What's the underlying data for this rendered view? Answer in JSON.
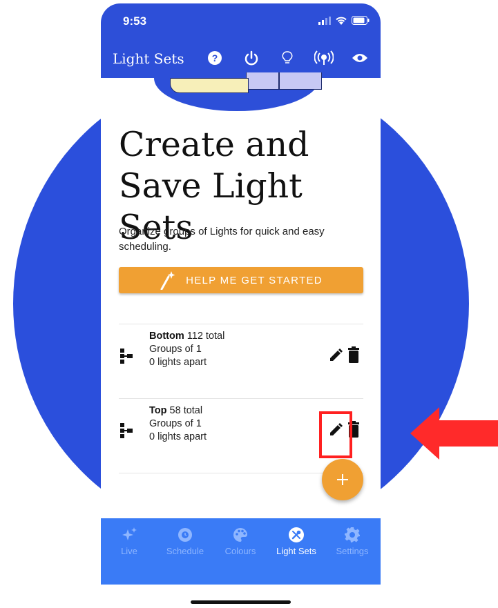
{
  "status_bar": {
    "time": "9:53"
  },
  "app_bar": {
    "title": "Light Sets",
    "icons": [
      "help-icon",
      "power-icon",
      "bulb-icon",
      "broadcast-icon",
      "eye-icon"
    ]
  },
  "hero": {
    "headline_line1": "Create and",
    "headline_line2": "Save Light Sets",
    "subtitle": "Organize groups of Lights for quick and easy scheduling."
  },
  "help_button": {
    "label": "HELP ME GET STARTED",
    "icon": "magic-wand-icon"
  },
  "light_sets": [
    {
      "name": "Bottom",
      "total": "112 total",
      "groups": "Groups of 1",
      "spacing": "0 lights apart"
    },
    {
      "name": "Top",
      "total": "58 total",
      "groups": "Groups of 1",
      "spacing": "0 lights apart"
    }
  ],
  "fab": {
    "label": "+"
  },
  "bottom_nav": [
    {
      "label": "Live",
      "icon": "sparkles-icon",
      "active": false
    },
    {
      "label": "Schedule",
      "icon": "schedule-icon",
      "active": false
    },
    {
      "label": "Colours",
      "icon": "palette-icon",
      "active": false
    },
    {
      "label": "Light Sets",
      "icon": "tools-icon",
      "active": true
    },
    {
      "label": "Settings",
      "icon": "gear-icon",
      "active": false
    }
  ],
  "colors": {
    "brand_blue": "#2d4fd8",
    "nav_blue": "#3a7bf6",
    "accent_orange": "#f0a033",
    "annotation_red": "#ff2020"
  }
}
